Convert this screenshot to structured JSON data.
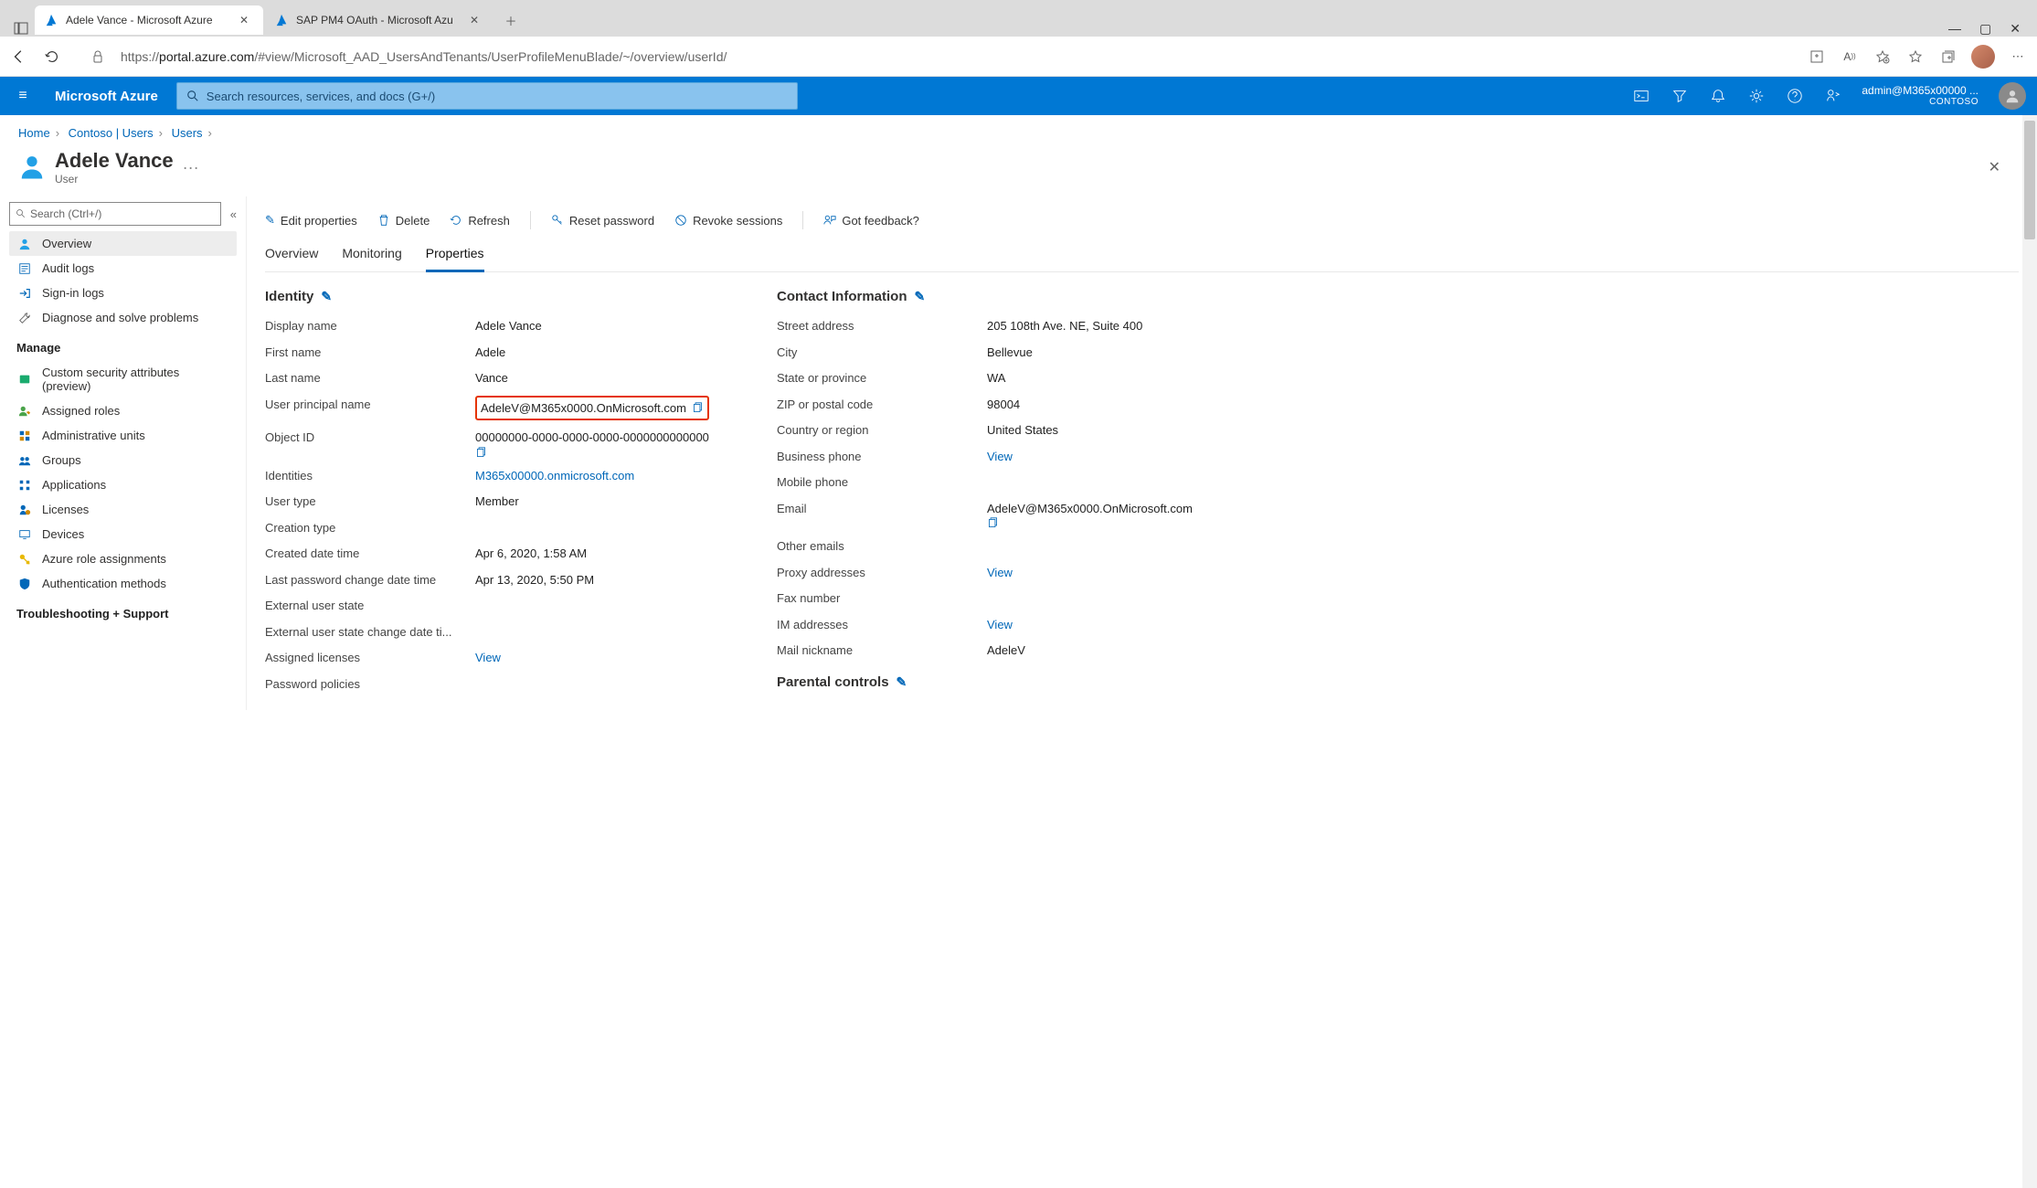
{
  "browser": {
    "tab1": "Adele Vance - Microsoft Azure",
    "tab2": "SAP PM4 OAuth - Microsoft Azu",
    "url_prefix": "https://",
    "url_host": "portal.azure.com",
    "url_path": "/#view/Microsoft_AAD_UsersAndTenants/UserProfileMenuBlade/~/overview/userId/"
  },
  "azure": {
    "brand": "Microsoft Azure",
    "search_placeholder": "Search resources, services, and docs (G+/)",
    "account": "admin@M365x00000",
    "account_suffix": "...",
    "directory": "CONTOSO"
  },
  "breadcrumb": {
    "b1": "Home",
    "b2": "Contoso | Users",
    "b3": "Users"
  },
  "page": {
    "title": "Adele Vance",
    "subtitle": "User",
    "more": "···"
  },
  "sidebar": {
    "search_ph": "Search (Ctrl+/)",
    "items": {
      "overview": "Overview",
      "audit": "Audit logs",
      "signin": "Sign-in logs",
      "diag": "Diagnose and solve problems"
    },
    "manage_h": "Manage",
    "manage": {
      "csa": "Custom security attributes (preview)",
      "roles": "Assigned roles",
      "au": "Administrative units",
      "groups": "Groups",
      "apps": "Applications",
      "lic": "Licenses",
      "dev": "Devices",
      "rbac": "Azure role assignments",
      "auth": "Authentication methods"
    },
    "ts_h": "Troubleshooting + Support"
  },
  "cmds": {
    "edit": "Edit properties",
    "delete": "Delete",
    "refresh": "Refresh",
    "reset": "Reset password",
    "revoke": "Revoke sessions",
    "feedback": "Got feedback?"
  },
  "tabs": {
    "overview": "Overview",
    "mon": "Monitoring",
    "props": "Properties"
  },
  "identity": {
    "h": "Identity",
    "k": {
      "dn": "Display name",
      "fn": "First name",
      "ln": "Last name",
      "upn": "User principal name",
      "oid": "Object ID",
      "ids": "Identities",
      "ut": "User type",
      "ct": "Creation type",
      "cdt": "Created date time",
      "pwd": "Last password change date time",
      "eus": "External user state",
      "eusd": "External user state change date ti...",
      "al": "Assigned licenses",
      "pp": "Password policies"
    },
    "v": {
      "dn": "Adele Vance",
      "fn": "Adele",
      "ln": "Vance",
      "upn": "AdeleV@M365x0000.OnMicrosoft.com",
      "oid": "00000000-0000-0000-0000-0000000000000",
      "ids": "M365x00000.onmicrosoft.com",
      "ut": "Member",
      "cdt": "Apr 6, 2020, 1:58 AM",
      "pwd": "Apr 13, 2020, 5:50 PM",
      "al": "View"
    }
  },
  "contact": {
    "h": "Contact Information",
    "k": {
      "sa": "Street address",
      "city": "City",
      "sp": "State or province",
      "zip": "ZIP or postal code",
      "cr": "Country or region",
      "bp": "Business phone",
      "mp": "Mobile phone",
      "em": "Email",
      "oe": "Other emails",
      "pa": "Proxy addresses",
      "fn": "Fax number",
      "im": "IM addresses",
      "mn": "Mail nickname"
    },
    "v": {
      "sa": "205 108th Ave. NE, Suite 400",
      "city": "Bellevue",
      "sp": "WA",
      "zip": "98004",
      "cr": "United States",
      "bp": "View",
      "em": "AdeleV@M365x0000.OnMicrosoft.com",
      "pa": "View",
      "im": "View",
      "mn": "AdeleV"
    }
  },
  "parental": {
    "h": "Parental controls"
  }
}
